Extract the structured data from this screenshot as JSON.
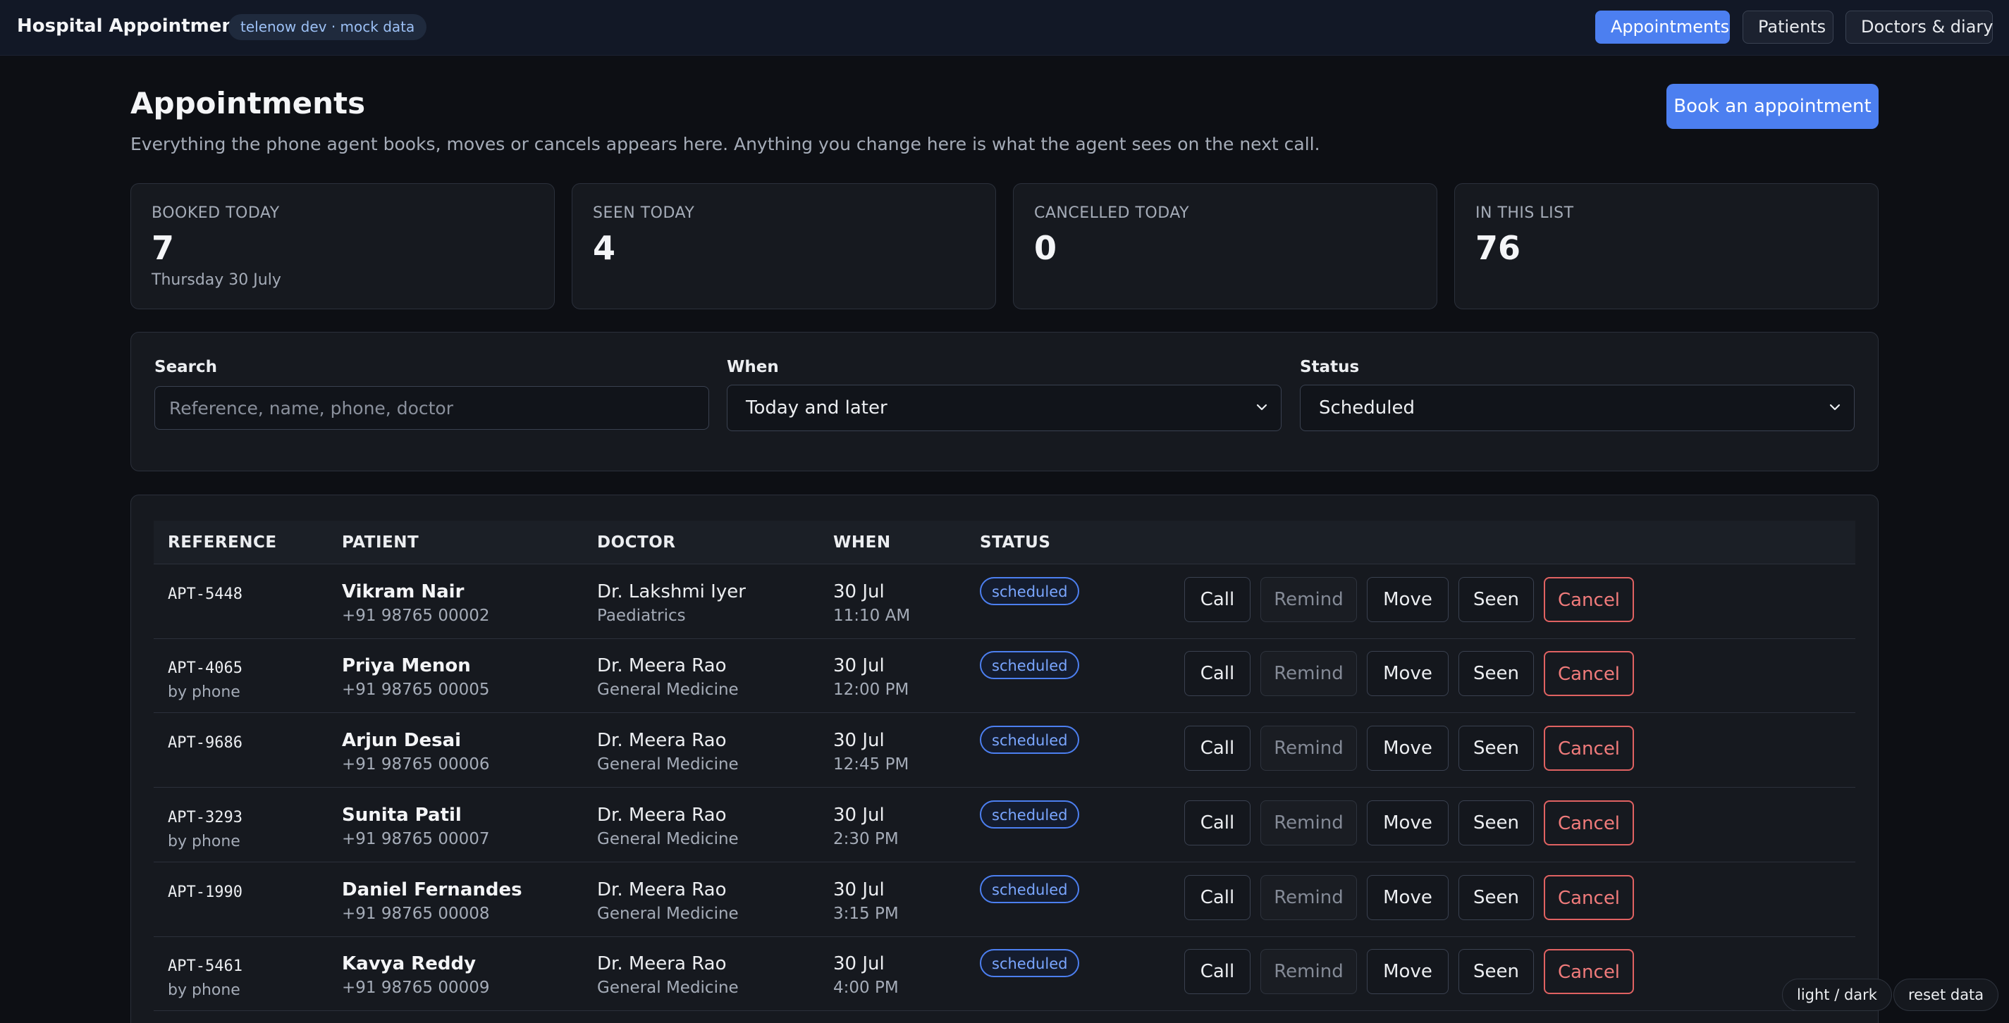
{
  "app": {
    "title": "Hospital Appointments",
    "env_badge": "telenow dev · mock data"
  },
  "nav": {
    "items": [
      {
        "label": "Appointments",
        "active": true
      },
      {
        "label": "Patients",
        "active": false
      },
      {
        "label": "Doctors & diary",
        "active": false
      }
    ]
  },
  "header": {
    "title": "Appointments",
    "subtitle": "Everything the phone agent books, moves or cancels appears here. Anything you change here is what the agent sees on the next call.",
    "book_button": "Book an appointment"
  },
  "stats": [
    {
      "label": "BOOKED TODAY",
      "value": "7",
      "note": "Thursday 30 July"
    },
    {
      "label": "SEEN TODAY",
      "value": "4",
      "note": ""
    },
    {
      "label": "CANCELLED TODAY",
      "value": "0",
      "note": ""
    },
    {
      "label": "IN THIS LIST",
      "value": "76",
      "note": ""
    }
  ],
  "filters": {
    "search_label": "Search",
    "search_placeholder": "Reference, name, phone, doctor",
    "search_value": "",
    "when_label": "When",
    "when_value": "Today and later",
    "status_label": "Status",
    "status_value": "Scheduled"
  },
  "table": {
    "headers": [
      "REFERENCE",
      "PATIENT",
      "DOCTOR",
      "WHEN",
      "STATUS"
    ],
    "actions": {
      "call": "Call",
      "remind": "Remind",
      "move": "Move",
      "seen": "Seen",
      "cancel": "Cancel"
    },
    "rows": [
      {
        "ref": "APT-5448",
        "ref_sub": "",
        "patient": "Vikram Nair",
        "phone": "+91 98765 00002",
        "doctor": "Dr. Lakshmi Iyer",
        "specialty": "Paediatrics",
        "date": "30 Jul",
        "time": "11:10 AM",
        "status": "scheduled"
      },
      {
        "ref": "APT-4065",
        "ref_sub": "by phone",
        "patient": "Priya Menon",
        "phone": "+91 98765 00005",
        "doctor": "Dr. Meera Rao",
        "specialty": "General Medicine",
        "date": "30 Jul",
        "time": "12:00 PM",
        "status": "scheduled"
      },
      {
        "ref": "APT-9686",
        "ref_sub": "",
        "patient": "Arjun Desai",
        "phone": "+91 98765 00006",
        "doctor": "Dr. Meera Rao",
        "specialty": "General Medicine",
        "date": "30 Jul",
        "time": "12:45 PM",
        "status": "scheduled"
      },
      {
        "ref": "APT-3293",
        "ref_sub": "by phone",
        "patient": "Sunita Patil",
        "phone": "+91 98765 00007",
        "doctor": "Dr. Meera Rao",
        "specialty": "General Medicine",
        "date": "30 Jul",
        "time": "2:30 PM",
        "status": "scheduled"
      },
      {
        "ref": "APT-1990",
        "ref_sub": "",
        "patient": "Daniel Fernandes",
        "phone": "+91 98765 00008",
        "doctor": "Dr. Meera Rao",
        "specialty": "General Medicine",
        "date": "30 Jul",
        "time": "3:15 PM",
        "status": "scheduled"
      },
      {
        "ref": "APT-5461",
        "ref_sub": "by phone",
        "patient": "Kavya Reddy",
        "phone": "+91 98765 00009",
        "doctor": "Dr. Meera Rao",
        "specialty": "General Medicine",
        "date": "30 Jul",
        "time": "4:00 PM",
        "status": "scheduled"
      }
    ]
  },
  "footer": {
    "theme_toggle": "light / dark",
    "reset": "reset data"
  },
  "colors": {
    "accent": "#4c7ff0",
    "danger": "#e06262",
    "background": "#0d0f14",
    "card": "#16191f"
  }
}
